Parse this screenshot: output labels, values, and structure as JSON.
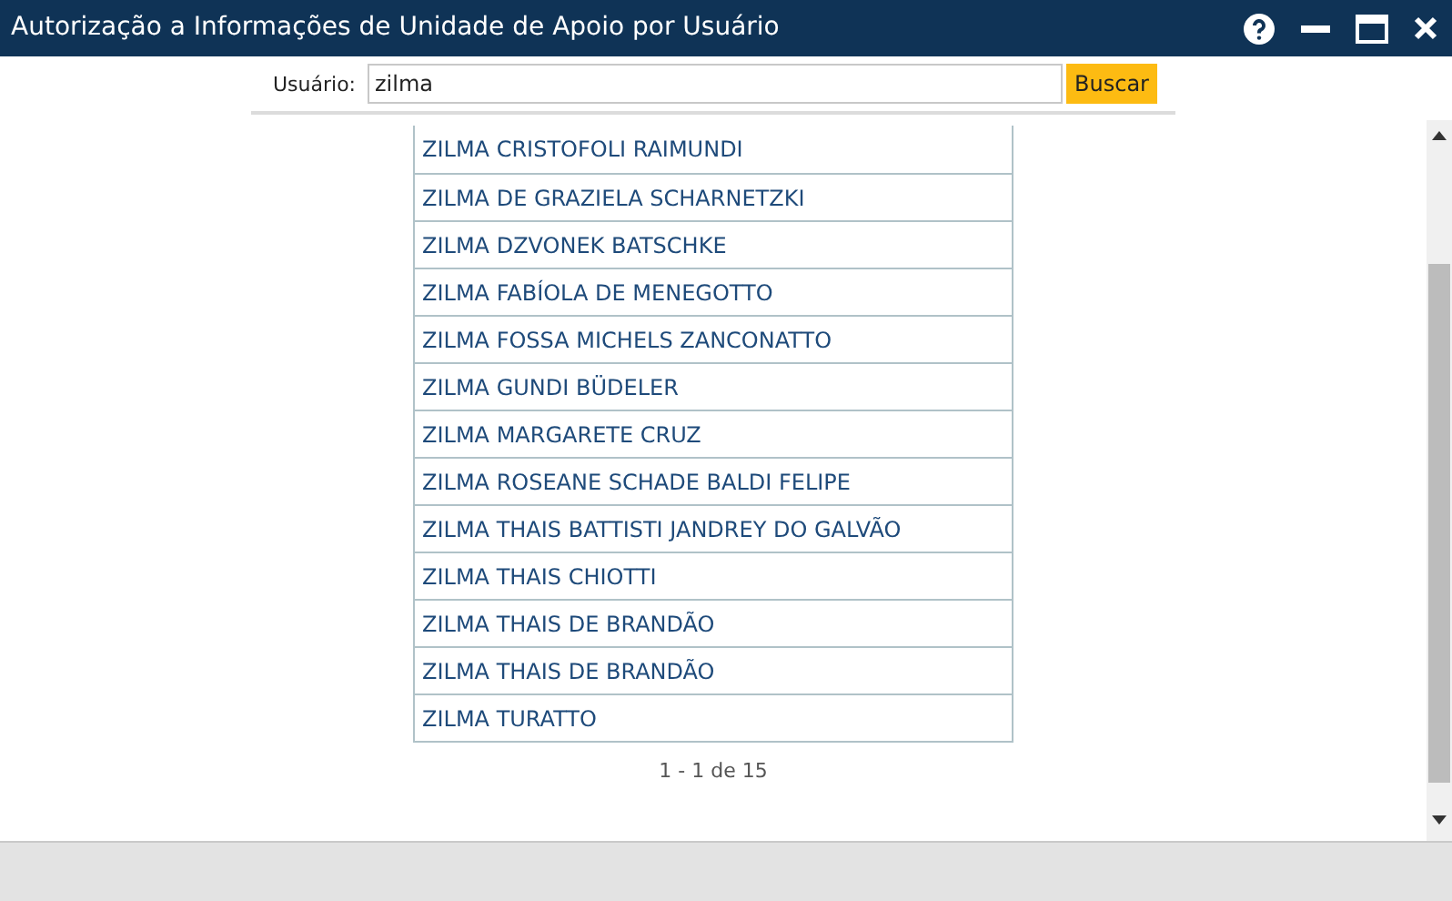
{
  "window": {
    "title": "Autorização a Informações de Unidade de Apoio por Usuário"
  },
  "search": {
    "label": "Usuário:",
    "value": "zilma",
    "button": "Buscar"
  },
  "results": [
    "ZILMA CRISTOFOLI RAIMUNDI",
    "ZILMA DE GRAZIELA SCHARNETZKI",
    "ZILMA DZVONEK BATSCHKE",
    "ZILMA FABÍOLA DE MENEGOTTO",
    "ZILMA FOSSA MICHELS ZANCONATTO",
    "ZILMA GUNDI BÜDELER",
    "ZILMA MARGARETE CRUZ",
    "ZILMA ROSEANE SCHADE BALDI FELIPE",
    "ZILMA THAIS BATTISTI JANDREY DO GALVÃO",
    "ZILMA THAIS CHIOTTI",
    "ZILMA THAIS DE BRANDÃO",
    "ZILMA THAIS DE BRANDÃO",
    "ZILMA TURATTO"
  ],
  "pagination": "1 - 1 de 15"
}
